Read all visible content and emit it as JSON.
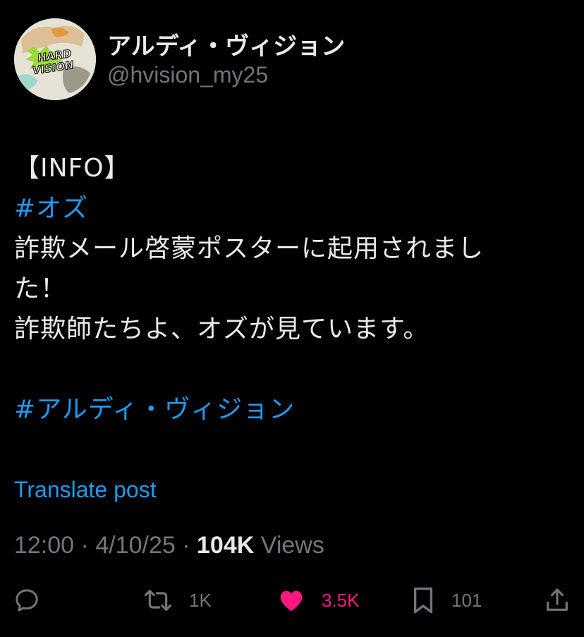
{
  "author": {
    "display_name": "アルディ・ヴィジョン",
    "handle": "@hvision_my25",
    "avatar_logo_text": "HARD VISION"
  },
  "post": {
    "lines": [
      "【INFO】",
      "#オズ",
      "詐欺メール啓蒙ポスターに起用されまし",
      "た！",
      "詐欺師たちよ、オズが見ています。",
      "",
      "#アルディ・ヴィジョン"
    ],
    "hashtags": [
      "#オズ",
      "#アルディ・ヴィジョン"
    ]
  },
  "translate_label": "Translate post",
  "meta": {
    "time": "12:00",
    "date": "4/10/25",
    "views_count": "104K",
    "views_label": "Views",
    "separator": "·"
  },
  "actions": {
    "reply": {
      "icon": "reply-icon",
      "count": ""
    },
    "repost": {
      "icon": "repost-icon",
      "count": "1K"
    },
    "like": {
      "icon": "heart-icon",
      "count": "3.5K",
      "liked": true
    },
    "bookmark": {
      "icon": "bookmark-icon",
      "count": "101"
    },
    "share": {
      "icon": "share-icon",
      "count": ""
    }
  },
  "colors": {
    "background": "#000000",
    "text": "#e7e9ea",
    "muted": "#71767b",
    "link": "#1d9bf0",
    "like": "#f91880"
  }
}
